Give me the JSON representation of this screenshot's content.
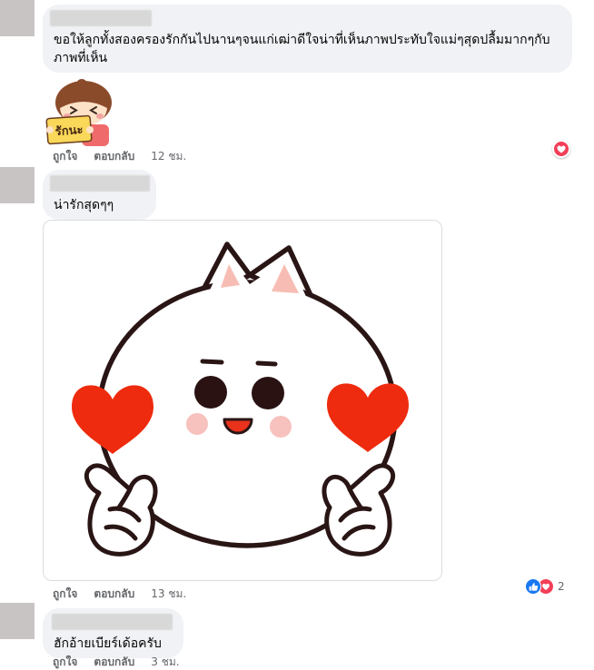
{
  "comments": [
    {
      "text": "ขอให้ลูกทั้งสองครองรักกันไปนานๆจนแก่เฒ่าดีใจน่าที่เห็นภาพประทับใจแม่ๆสุดปลื้มมากๆกับภาพที่เห็น",
      "sticker": {
        "icon": "girl-love-sign-sticker",
        "sign_text": "รักนะ"
      },
      "like_label": "ถูกใจ",
      "reply_label": "ตอบกลับ",
      "time": "12 ชม.",
      "reactions": {
        "icons": [
          "heart-icon"
        ]
      }
    },
    {
      "text": "น่ารักสุดๆๆ",
      "sticker": {
        "icon": "white-cat-finger-heart-sticker"
      },
      "like_label": "ถูกใจ",
      "reply_label": "ตอบกลับ",
      "time": "13 ชม.",
      "reactions": {
        "icons": [
          "like-icon",
          "heart-icon"
        ],
        "count": "2"
      }
    },
    {
      "text": "ฮักอ้ายเบียร์เด้อครับ",
      "like_label": "ถูกใจ",
      "reply_label": "ตอบกลับ",
      "time": "3 ชม."
    }
  ],
  "colors": {
    "bubble_bg": "#f0f2f5",
    "text": "#050505",
    "secondary_text": "#65676b",
    "like_blue": "#1877f2",
    "love_red": "#f33e58",
    "sticker_heart": "#ee2b0e"
  }
}
